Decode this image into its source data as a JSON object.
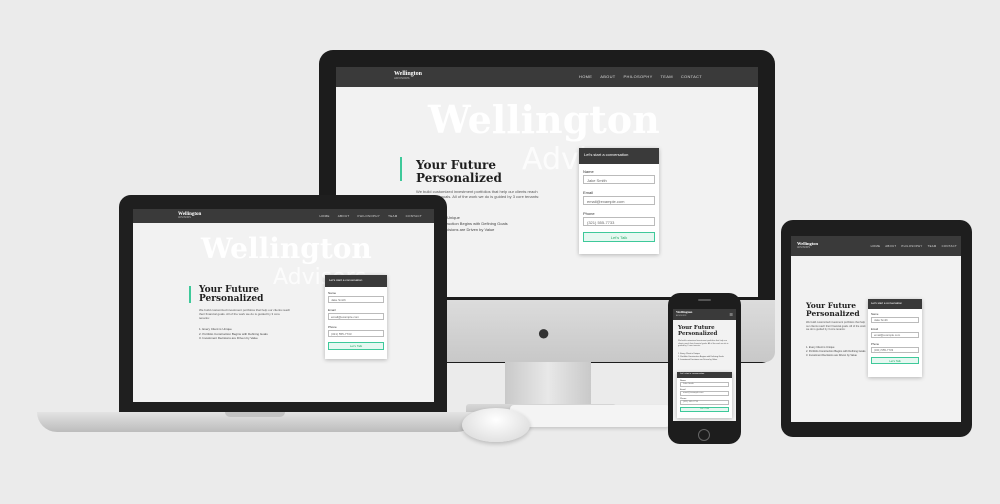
{
  "brand": {
    "name": "Wellington",
    "sub": "ADVISORS"
  },
  "nav": [
    "HOME",
    "ABOUT",
    "PHILOSOPHY",
    "TEAM",
    "CONTACT"
  ],
  "watermark": {
    "big": "Wellington",
    "small": "Advisors"
  },
  "hero": {
    "line1": "Your Future",
    "line2": "Personalized"
  },
  "description": "We build customized investment portfolios that help our clients reach their financial goals. All of the work we do is guided by 3 core tenants:",
  "steps": [
    "1. Every Client is Unique",
    "2. Portfolio Construction Begins with Defining Goals",
    "3. Investment Decisions are Driven by Value"
  ],
  "form": {
    "title": "Let's start a conversation",
    "name_label": "Name",
    "name_value": "Jake Smith",
    "email_label": "Email",
    "email_value": "email@example.com",
    "phone_label": "Phone",
    "phone_value": "(321) 555-7733",
    "button": "Let's Talk"
  },
  "colors": {
    "accent": "#3ec99a",
    "nav": "#3a3a3a",
    "bezel": "#1c1c1c"
  }
}
